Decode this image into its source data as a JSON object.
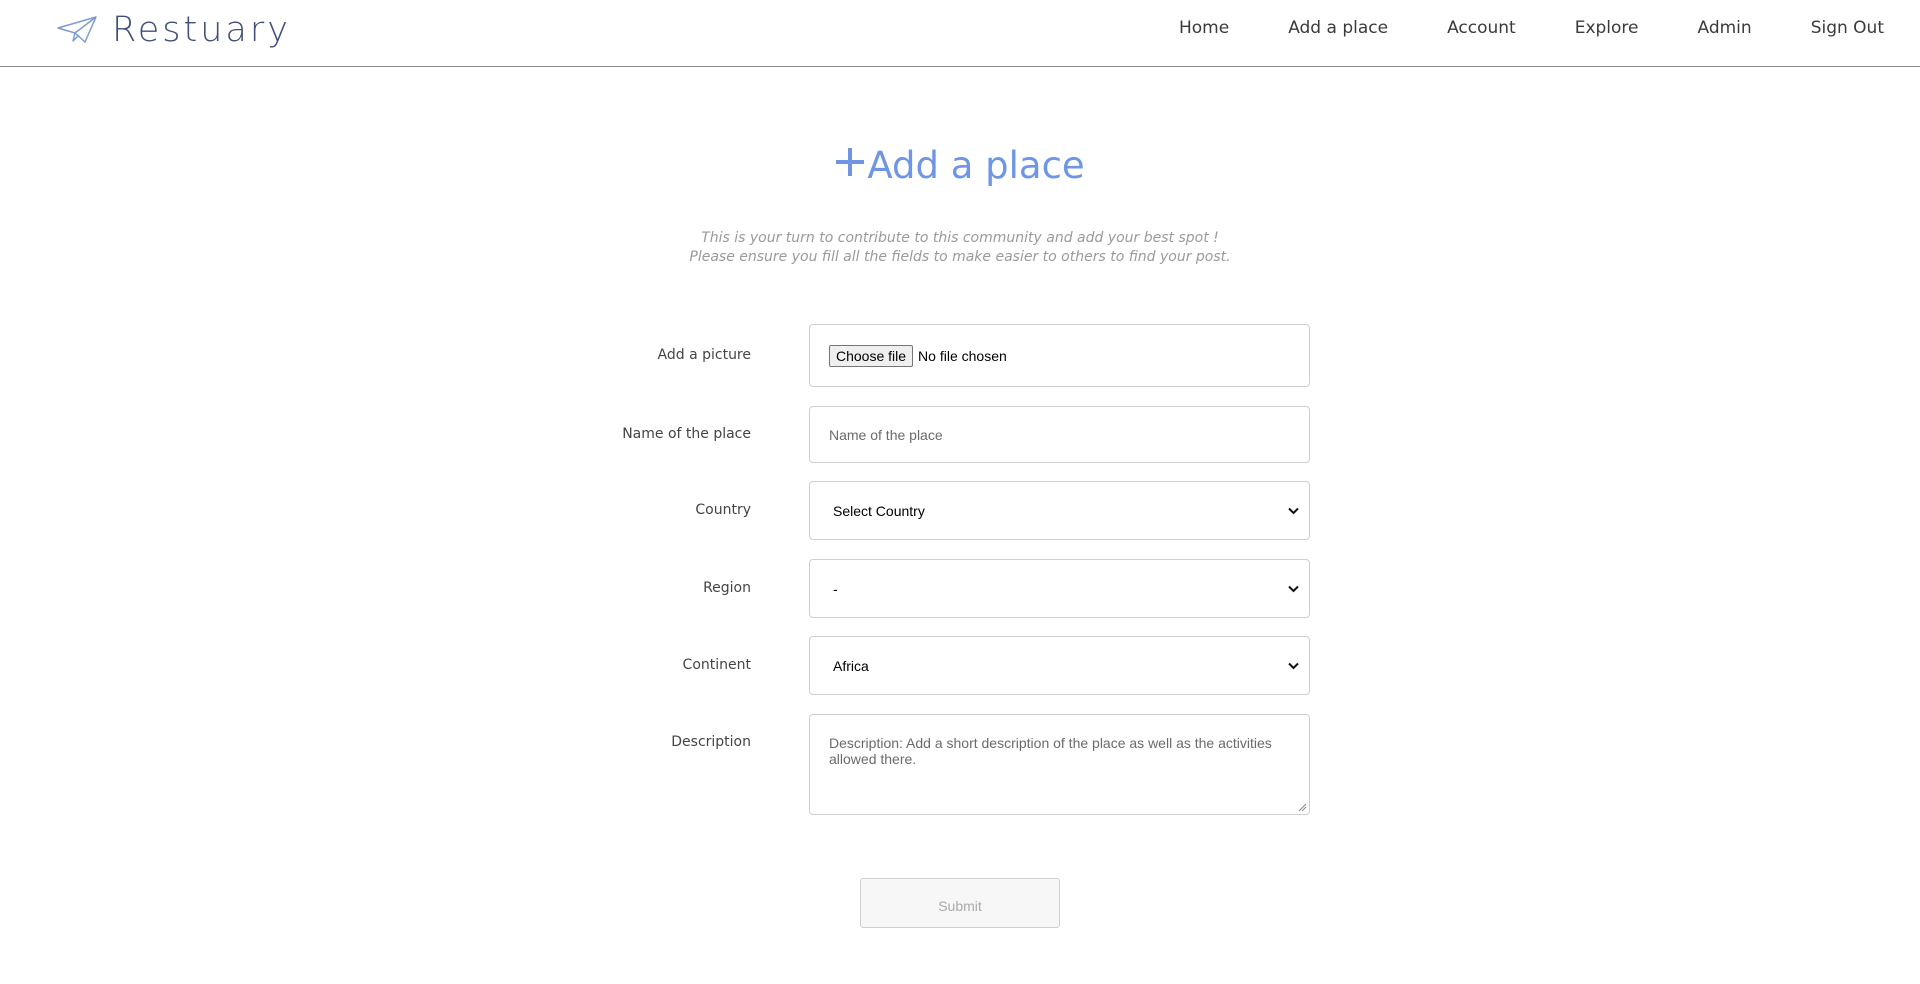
{
  "brand": {
    "name": "Restuary",
    "icon": "paper-plane-icon"
  },
  "nav": {
    "home": "Home",
    "add_place": "Add a place",
    "account": "Account",
    "explore": "Explore",
    "admin": "Admin",
    "sign_out": "Sign Out"
  },
  "page": {
    "title": "Add a place",
    "title_icon": "plus-icon",
    "subtitle_line1": "This is your turn to contribute to this community and add your best spot !",
    "subtitle_line2": "Please ensure you fill all the fields to make easier to others to find your post."
  },
  "form": {
    "picture": {
      "label": "Add a picture",
      "button": "Choose file",
      "status": "No file chosen"
    },
    "name": {
      "label": "Name of the place",
      "placeholder": "Name of the place",
      "value": ""
    },
    "country": {
      "label": "Country",
      "selected": "Select Country"
    },
    "region": {
      "label": "Region",
      "selected": "-"
    },
    "continent": {
      "label": "Continent",
      "selected": "Africa"
    },
    "description": {
      "label": "Description",
      "placeholder": "Description: Add a short description of the place as well as the activities allowed there."
    },
    "submit": "Submit"
  },
  "colors": {
    "accent": "#6e96e4",
    "brand_text": "#3f4f78",
    "subtitle_text": "#9a9a9a",
    "border": "#cfcfcf"
  }
}
